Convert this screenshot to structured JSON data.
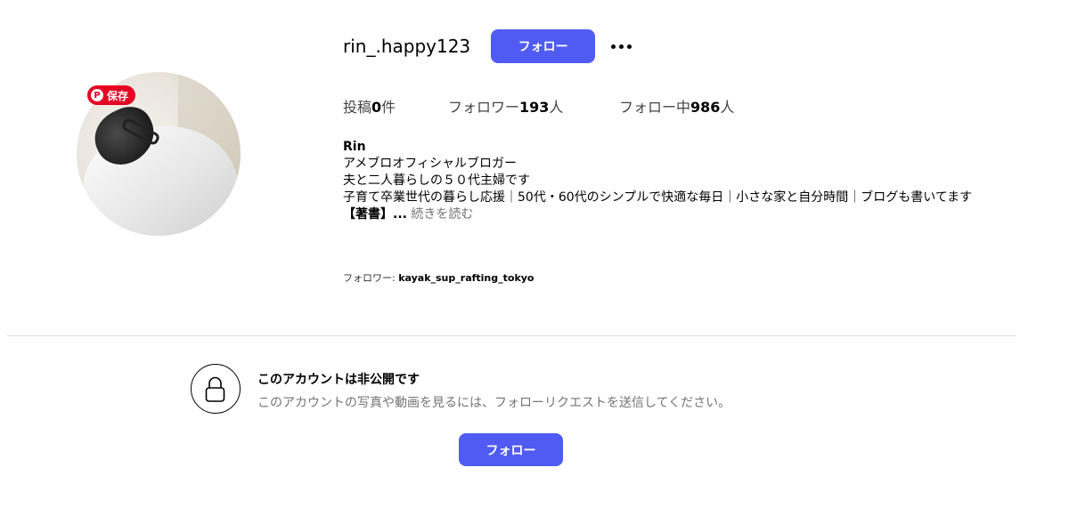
{
  "profile": {
    "username": "rin_.happy123",
    "follow_label": "フォロー",
    "save_badge_label": "保存",
    "save_badge_pin": "P"
  },
  "stats": {
    "posts_label": "投稿",
    "posts_count": "0",
    "posts_unit": "件",
    "followers_label": "フォロワー",
    "followers_count": "193",
    "followers_unit": "人",
    "following_label": "フォロー中",
    "following_count": "986",
    "following_unit": "人"
  },
  "bio": {
    "name": "Rin",
    "line1": "アメブロオフィシャルブロガー",
    "line2": "夫と二人暮らしの５０代主婦です",
    "line3": "子育て卒業世代の暮らし応援｜50代・60代のシンプルで快適な毎日｜小さな家と自分時間｜ブログも書いてます",
    "line4": "【著書】...",
    "read_more": "続きを読む"
  },
  "followed_by": {
    "label": "フォロワー: ",
    "account": "kayak_sup_rafting_tokyo"
  },
  "private": {
    "title": "このアカウントは非公開です",
    "description": "このアカウントの写真や動画を見るには、フォローリクエストを送信してください。",
    "follow_label": "フォロー"
  },
  "colors": {
    "accent": "#4f5bf3",
    "pinterest": "#e60023"
  }
}
